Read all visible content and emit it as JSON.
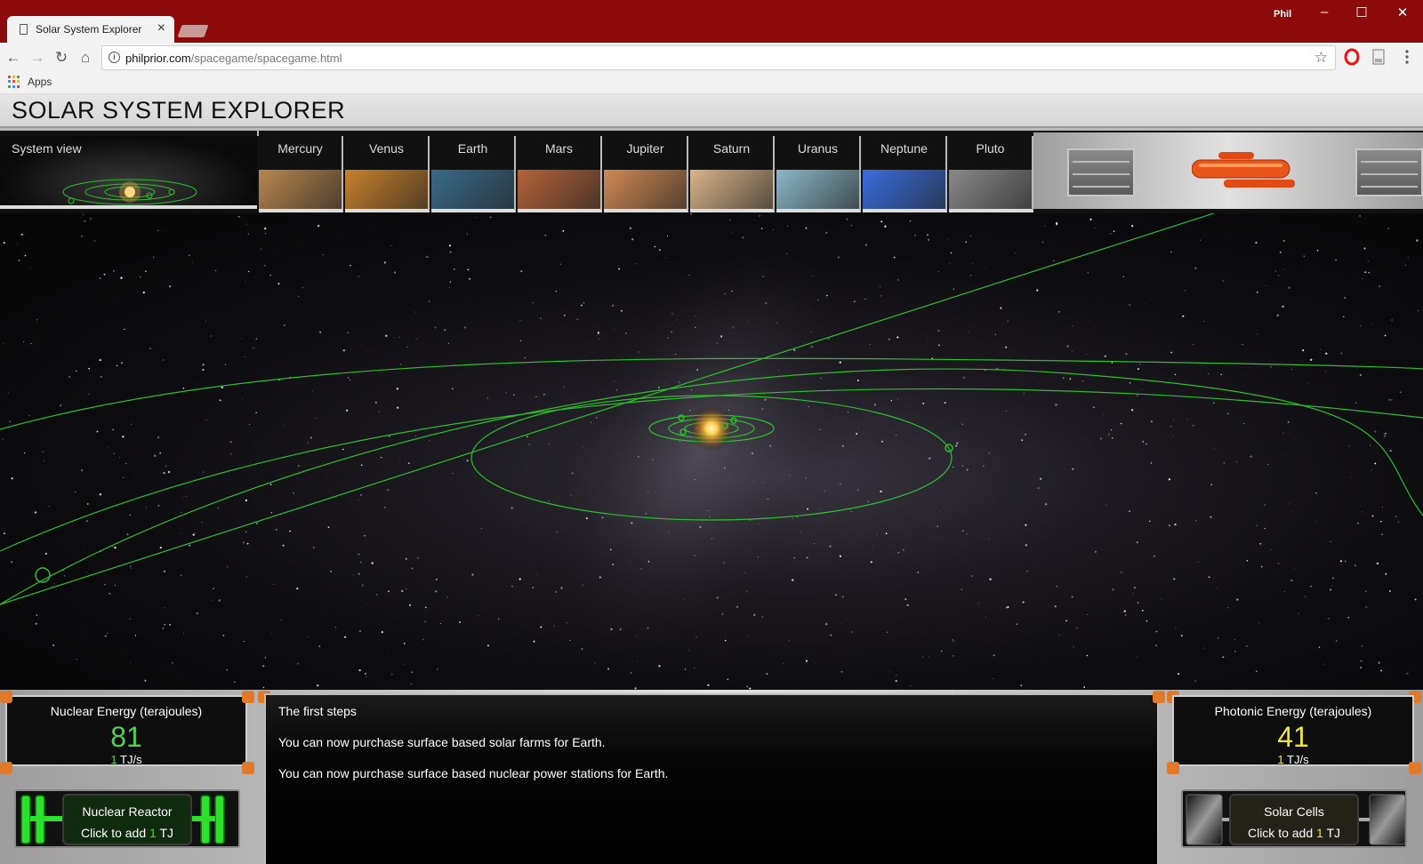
{
  "browser": {
    "tab_title": "Solar System Explorer",
    "tab_close": "×",
    "profile_name": "Phil",
    "minimize": "–",
    "maximize": "☐",
    "close": "✕",
    "back": "←",
    "forward": "→",
    "reload": "↻",
    "home": "⌂",
    "url_host": "philprior.com",
    "url_path": "/spacegame/spacegame.html",
    "star": "☆",
    "bookmarks_apps": "Apps"
  },
  "page": {
    "title": "SOLAR SYSTEM EXPLORER"
  },
  "planet_bar": {
    "system_view": "System view",
    "planets": [
      {
        "label": "Mercury",
        "color": "#b8874f"
      },
      {
        "label": "Venus",
        "color": "#c8822c"
      },
      {
        "label": "Earth",
        "color": "#3a6a8a"
      },
      {
        "label": "Mars",
        "color": "#b5633a"
      },
      {
        "label": "Jupiter",
        "color": "#d08a55"
      },
      {
        "label": "Saturn",
        "color": "#d9b48a"
      },
      {
        "label": "Uranus",
        "color": "#8cb8c8"
      },
      {
        "label": "Neptune",
        "color": "#3a6ee0"
      },
      {
        "label": "Pluto",
        "color": "#8a8a8a"
      }
    ]
  },
  "nuclear": {
    "title": "Nuclear Energy (terajoules)",
    "value": "81",
    "rate_num": "1",
    "rate_unit": " TJ/s",
    "value_color": "#4fd14f",
    "button_title": "Nuclear Reactor",
    "button_prefix": "Click to add ",
    "button_num": "1",
    "button_unit": " TJ"
  },
  "photonic": {
    "title": "Photonic Energy (terajoules)",
    "value": "41",
    "rate_num": "1",
    "rate_unit": " TJ/s",
    "value_color": "#f0e23a",
    "button_title": "Solar Cells",
    "button_prefix": "Click to add ",
    "button_num": "1",
    "button_unit": " TJ"
  },
  "messages": [
    "The first steps",
    "You can now purchase surface based solar farms for Earth.",
    "You can now purchase surface based nuclear power stations for Earth."
  ],
  "colors": {
    "orbit": "#2fbf2f",
    "titlebar": "#8c0a0a",
    "accent_orange": "#e07a2a"
  }
}
